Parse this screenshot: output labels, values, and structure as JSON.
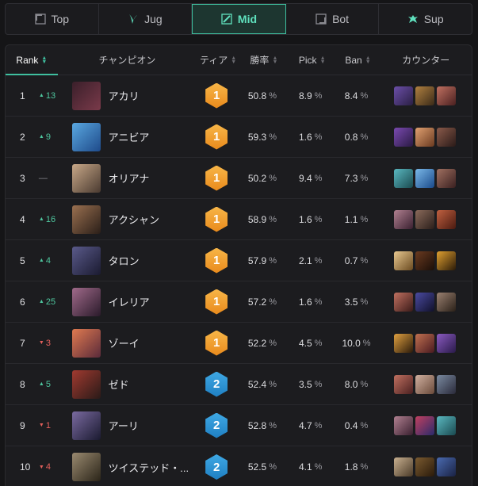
{
  "lanes": [
    {
      "label": "Top",
      "icon": "top-lane-icon",
      "active": false
    },
    {
      "label": "Jug",
      "icon": "jungle-icon",
      "active": false
    },
    {
      "label": "Mid",
      "icon": "mid-lane-icon",
      "active": true
    },
    {
      "label": "Bot",
      "icon": "bot-lane-icon",
      "active": false
    },
    {
      "label": "Sup",
      "icon": "support-icon",
      "active": false
    }
  ],
  "headers": {
    "rank": "Rank",
    "champion": "チャンピオン",
    "tier": "ティア",
    "winrate": "勝率",
    "pick": "Pick",
    "ban": "Ban",
    "counter": "カウンター"
  },
  "percent_sign": "%",
  "colors": {
    "accent": "#3fbf9f",
    "up": "#4fc79f",
    "down": "#e5605c",
    "tier1": "#f2a33a",
    "tier2": "#2f93d6"
  },
  "rows": [
    {
      "rank": "1",
      "dir": "up",
      "delta": "13",
      "name": "アカリ",
      "tier": "1",
      "winrate": "50.8",
      "pick": "8.9",
      "ban": "8.4",
      "portrait": [
        "#3a1f2a",
        "#7a3a4a"
      ],
      "counters": [
        [
          "#6b4fa8",
          "#2a1f44"
        ],
        [
          "#b08040",
          "#3a2a18"
        ],
        [
          "#c07060",
          "#4a2020"
        ]
      ]
    },
    {
      "rank": "2",
      "dir": "up",
      "delta": "9",
      "name": "アニビア",
      "tier": "1",
      "winrate": "59.3",
      "pick": "1.6",
      "ban": "0.8",
      "portrait": [
        "#5aa8e0",
        "#1e4a8a"
      ],
      "counters": [
        [
          "#7a4ab0",
          "#2a1a44"
        ],
        [
          "#e0a070",
          "#6a3a20"
        ],
        [
          "#8a5a4a",
          "#2a1a18"
        ]
      ]
    },
    {
      "rank": "3",
      "dir": "same",
      "delta": "—",
      "name": "オリアナ",
      "tier": "1",
      "winrate": "50.2",
      "pick": "9.4",
      "ban": "7.3",
      "portrait": [
        "#c8a888",
        "#4a3a30"
      ],
      "counters": [
        [
          "#5ab8c0",
          "#1a4a50"
        ],
        [
          "#7ab8e8",
          "#1a4a8a"
        ],
        [
          "#a07060",
          "#3a2020"
        ]
      ]
    },
    {
      "rank": "4",
      "dir": "up",
      "delta": "16",
      "name": "アクシャン",
      "tier": "1",
      "winrate": "58.9",
      "pick": "1.6",
      "ban": "1.1",
      "portrait": [
        "#9a7050",
        "#2a1e18"
      ],
      "counters": [
        [
          "#b08090",
          "#3a2030"
        ],
        [
          "#8a6a5a",
          "#2a1e1a"
        ],
        [
          "#c06040",
          "#4a1a10"
        ]
      ]
    },
    {
      "rank": "5",
      "dir": "up",
      "delta": "4",
      "name": "タロン",
      "tier": "1",
      "winrate": "57.9",
      "pick": "2.1",
      "ban": "0.7",
      "portrait": [
        "#5a5a8a",
        "#1a1a30"
      ],
      "counters": [
        [
          "#e8c890",
          "#6a4a20"
        ],
        [
          "#6a3a20",
          "#1a0e08"
        ],
        [
          "#e0a030",
          "#2a1a08"
        ]
      ]
    },
    {
      "rank": "6",
      "dir": "up",
      "delta": "25",
      "name": "イレリア",
      "tier": "1",
      "winrate": "57.2",
      "pick": "1.6",
      "ban": "3.5",
      "portrait": [
        "#a06a8a",
        "#2a1a2a"
      ],
      "counters": [
        [
          "#c07060",
          "#3a1a18"
        ],
        [
          "#4a4aa0",
          "#10102a"
        ],
        [
          "#9a8070",
          "#2a2018"
        ]
      ]
    },
    {
      "rank": "7",
      "dir": "down",
      "delta": "3",
      "name": "ゾーイ",
      "tier": "1",
      "winrate": "52.2",
      "pick": "4.5",
      "ban": "10.0",
      "portrait": [
        "#e07a50",
        "#5a2a3a"
      ],
      "counters": [
        [
          "#e0a040",
          "#2a1a0a"
        ],
        [
          "#c07050",
          "#4a1a20"
        ],
        [
          "#8a5ac0",
          "#2a1a4a"
        ]
      ]
    },
    {
      "rank": "8",
      "dir": "up",
      "delta": "5",
      "name": "ゼド",
      "tier": "2",
      "winrate": "52.4",
      "pick": "3.5",
      "ban": "8.0",
      "portrait": [
        "#a03a30",
        "#2a1a18"
      ],
      "counters": [
        [
          "#c07060",
          "#4a2020"
        ],
        [
          "#d0b0a0",
          "#6a4a3a"
        ],
        [
          "#7a8aa0",
          "#2a2a3a"
        ]
      ]
    },
    {
      "rank": "9",
      "dir": "down",
      "delta": "1",
      "name": "アーリ",
      "tier": "2",
      "winrate": "52.8",
      "pick": "4.7",
      "ban": "0.4",
      "portrait": [
        "#7a6aa0",
        "#1a1a30"
      ],
      "counters": [
        [
          "#b08090",
          "#3a2030"
        ],
        [
          "#c04060",
          "#2a2a6a"
        ],
        [
          "#5ab8c0",
          "#1a4a50"
        ]
      ]
    },
    {
      "rank": "10",
      "dir": "down",
      "delta": "4",
      "name": "ツイステッド・...",
      "tier": "2",
      "winrate": "52.5",
      "pick": "4.1",
      "ban": "1.8",
      "portrait": [
        "#9a8a70",
        "#2a2418"
      ],
      "counters": [
        [
          "#c8b090",
          "#4a3a28"
        ],
        [
          "#7a5a30",
          "#2a1a0a"
        ],
        [
          "#4a6ab0",
          "#1a2244"
        ]
      ]
    }
  ]
}
